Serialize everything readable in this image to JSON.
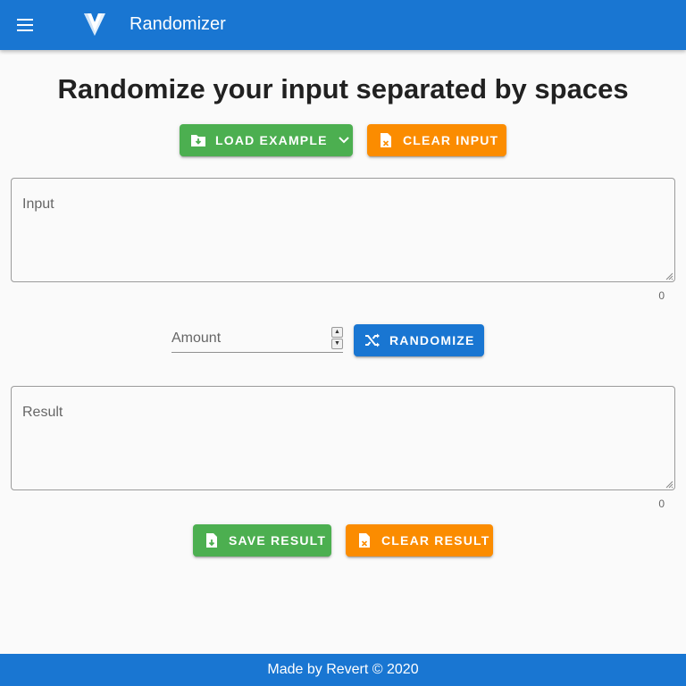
{
  "appbar": {
    "title": "Randomizer",
    "menu_icon": "hamburger-menu-icon",
    "logo": "vuetify-logo"
  },
  "page_title": "Randomize your input separated by spaces",
  "input_actions": {
    "load_example_label": "LOAD EXAMPLE",
    "clear_input_label": "CLEAR INPUT"
  },
  "input": {
    "label": "Input",
    "value": "",
    "counter": "0"
  },
  "amount": {
    "label": "Amount",
    "value": ""
  },
  "randomize_label": "RANDOMIZE",
  "result": {
    "label": "Result",
    "value": "",
    "counter": "0"
  },
  "result_actions": {
    "save_result_label": "SAVE RESULT",
    "clear_result_label": "CLEAR RESULT"
  },
  "footer": {
    "text": "Made by Revert © 2020"
  },
  "colors": {
    "primary": "#1976d2",
    "success": "#4caf50",
    "warning": "#fb8c00"
  }
}
